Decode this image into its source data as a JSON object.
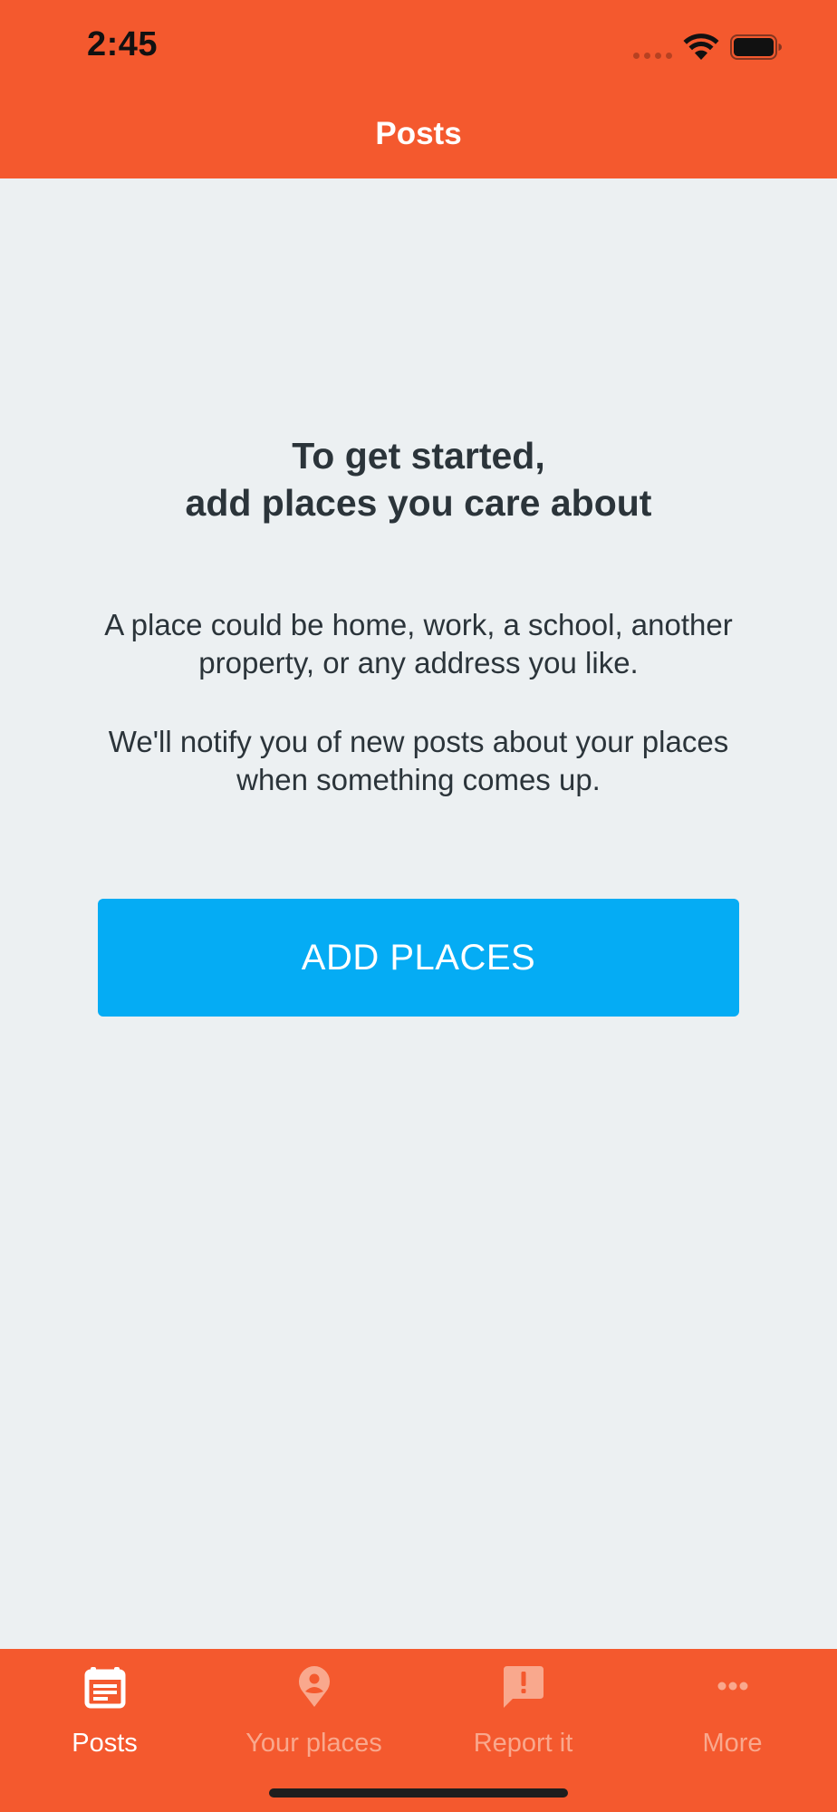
{
  "status_bar": {
    "time": "2:45"
  },
  "nav": {
    "title": "Posts"
  },
  "main": {
    "heading_line1": "To get started,",
    "heading_line2": "add places you care about",
    "paragraph1_line1": "A place could be home, work, a school, another",
    "paragraph1_line2": "property, or any address you like.",
    "paragraph2_line1": "We'll notify you of new posts about your places",
    "paragraph2_line2": "when something comes up.",
    "button_label": "ADD PLACES"
  },
  "tabs": [
    {
      "label": "Posts",
      "icon": "posts-icon",
      "active": true
    },
    {
      "label": "Your places",
      "icon": "place-pin-icon",
      "active": false
    },
    {
      "label": "Report it",
      "icon": "report-icon",
      "active": false
    },
    {
      "label": "More",
      "icon": "more-icon",
      "active": false
    }
  ],
  "colors": {
    "brand": "#F4592E",
    "button": "#05ACF4",
    "background": "#ECF0F2",
    "text": "#2B343A",
    "tab_inactive": "#F9A88D"
  }
}
